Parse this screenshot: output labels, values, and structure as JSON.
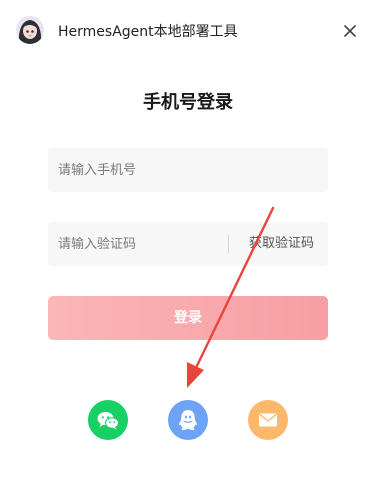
{
  "header": {
    "title": "HermesAgent本地部署工具",
    "avatar_icon": "anime-girl-avatar",
    "close_icon": "close-icon"
  },
  "login": {
    "title": "手机号登录",
    "phone_placeholder": "请输入手机号",
    "phone_value": "",
    "code_placeholder": "请输入验证码",
    "code_value": "",
    "get_code_label": "获取验证码",
    "submit_label": "登录"
  },
  "social": [
    {
      "icon": "wechat-icon",
      "color": "#19d065"
    },
    {
      "icon": "qq-icon",
      "color": "#6ea4f7"
    },
    {
      "icon": "mail-icon",
      "color": "#fdb86b"
    }
  ],
  "colors": {
    "login_button": "#f9a8ab",
    "annotation_arrow": "#e8453c",
    "field_background": "#f7f7f7"
  }
}
